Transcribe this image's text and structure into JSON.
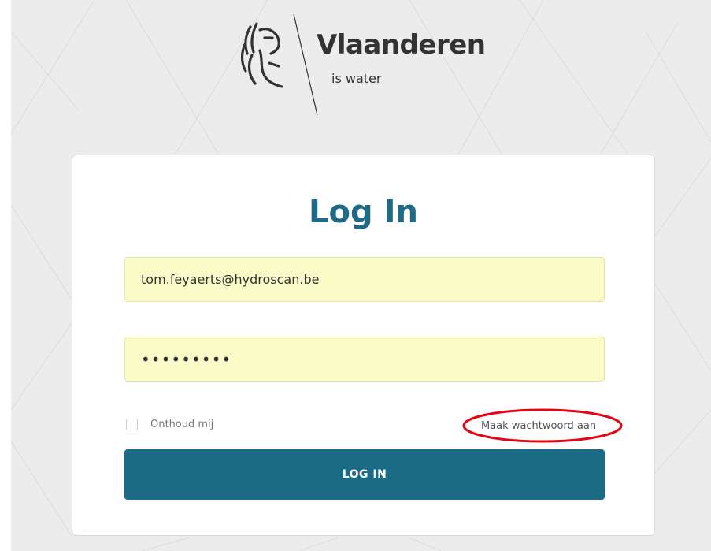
{
  "brand": {
    "name": "Vlaanderen",
    "tagline": "is water",
    "logo_icon": "flemish-lion-icon"
  },
  "login": {
    "title": "Log In",
    "email_value": "tom.feyaerts@hydroscan.be",
    "password_value": "•••••••••",
    "remember_label": "Onthoud mij",
    "remember_checked": false,
    "create_password_link": "Maak wachtwoord aan",
    "submit_label": "LOG IN"
  },
  "colors": {
    "title": "#1f6b86",
    "button": "#1b6b87",
    "field_autofill": "#fafcc8",
    "annotation": "#e30613"
  }
}
